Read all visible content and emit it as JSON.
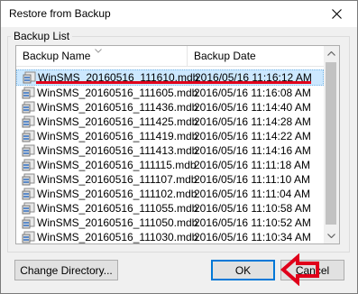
{
  "window": {
    "title": "Restore from Backup"
  },
  "group": {
    "label": "Backup List"
  },
  "list": {
    "columns": {
      "name": "Backup Name",
      "date": "Backup Date"
    },
    "rows": [
      {
        "name": "WinSMS_20160516_111610.mdb",
        "date": "2016/05/16 11:16:12 AM",
        "selected": true
      },
      {
        "name": "WinSMS_20160516_111605.mdb",
        "date": "2016/05/16 11:16:08 AM"
      },
      {
        "name": "WinSMS_20160516_111436.mdb",
        "date": "2016/05/16 11:14:40 AM"
      },
      {
        "name": "WinSMS_20160516_111425.mdb",
        "date": "2016/05/16 11:14:28 AM"
      },
      {
        "name": "WinSMS_20160516_111419.mdb",
        "date": "2016/05/16 11:14:22 AM"
      },
      {
        "name": "WinSMS_20160516_111413.mdb",
        "date": "2016/05/16 11:14:16 AM"
      },
      {
        "name": "WinSMS_20160516_111115.mdb",
        "date": "2016/05/16 11:11:18 AM"
      },
      {
        "name": "WinSMS_20160516_111107.mdb",
        "date": "2016/05/16 11:11:10 AM"
      },
      {
        "name": "WinSMS_20160516_111102.mdb",
        "date": "2016/05/16 11:11:04 AM"
      },
      {
        "name": "WinSMS_20160516_111055.mdb",
        "date": "2016/05/16 11:10:58 AM"
      },
      {
        "name": "WinSMS_20160516_111050.mdb",
        "date": "2016/05/16 11:10:52 AM"
      },
      {
        "name": "WinSMS_20160516_111030.mdb",
        "date": "2016/05/16 11:10:34 AM"
      }
    ]
  },
  "buttons": {
    "change_directory": "Change Directory...",
    "ok": "OK",
    "cancel": "Cancel"
  },
  "icons": {
    "close": "close-icon",
    "sort": "sort-indicator-icon",
    "row": "database-file-icon"
  },
  "colors": {
    "selection": "#cce8ff",
    "focus_border": "#0078d7",
    "annotation_red": "#e0001a"
  }
}
